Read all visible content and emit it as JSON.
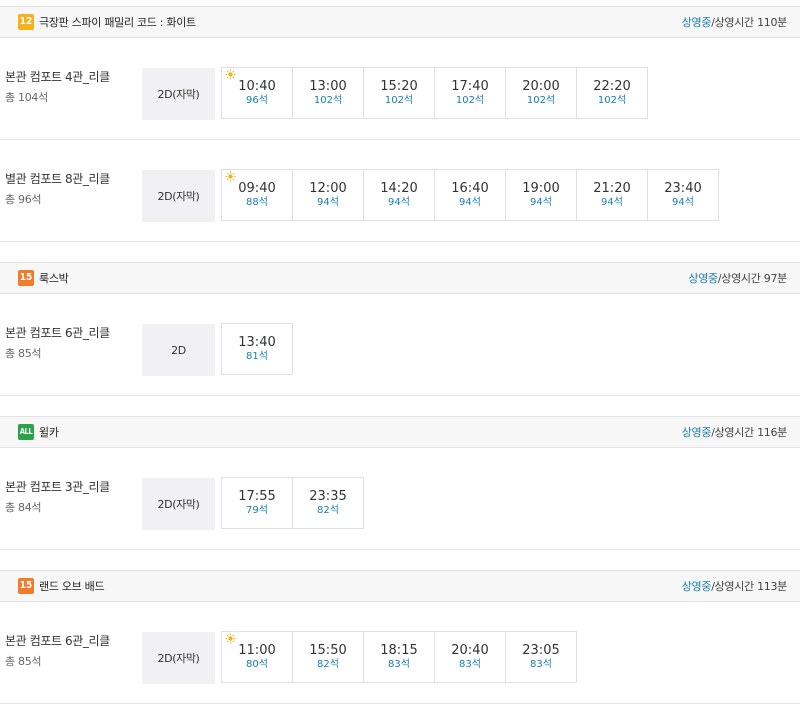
{
  "movies": [
    {
      "rating": "12",
      "title": "극장판 스파이 패밀리 코드 : 화이트",
      "status_on": "상영중",
      "status_rest": "/상영시간 110분",
      "halls": [
        {
          "name": "본관 컴포트 4관_리클",
          "total": "총 104석",
          "format": "2D(자막)",
          "times": [
            {
              "time": "10:40",
              "seats": "96석",
              "icon": "sun-icon"
            },
            {
              "time": "13:00",
              "seats": "102석"
            },
            {
              "time": "15:20",
              "seats": "102석"
            },
            {
              "time": "17:40",
              "seats": "102석"
            },
            {
              "time": "20:00",
              "seats": "102석"
            },
            {
              "time": "22:20",
              "seats": "102석"
            }
          ]
        },
        {
          "name": "별관 컴포트 8관_리클",
          "total": "총 96석",
          "format": "2D(자막)",
          "times": [
            {
              "time": "09:40",
              "seats": "88석",
              "icon": "sun-icon"
            },
            {
              "time": "12:00",
              "seats": "94석"
            },
            {
              "time": "14:20",
              "seats": "94석"
            },
            {
              "time": "16:40",
              "seats": "94석"
            },
            {
              "time": "19:00",
              "seats": "94석"
            },
            {
              "time": "21:20",
              "seats": "94석"
            },
            {
              "time": "23:40",
              "seats": "94석"
            }
          ]
        }
      ]
    },
    {
      "rating": "15",
      "title": "룩스박",
      "status_on": "상영중",
      "status_rest": "/상영시간 97분",
      "halls": [
        {
          "name": "본관 컴포트 6관_리클",
          "total": "총 85석",
          "format": "2D",
          "times": [
            {
              "time": "13:40",
              "seats": "81석"
            }
          ]
        }
      ]
    },
    {
      "rating": "ALL",
      "title": "윌카",
      "status_on": "상영중",
      "status_rest": "/상영시간 116분",
      "halls": [
        {
          "name": "본관 컴포트 3관_리클",
          "total": "총 84석",
          "format": "2D(자막)",
          "times": [
            {
              "time": "17:55",
              "seats": "79석"
            },
            {
              "time": "23:35",
              "seats": "82석"
            }
          ]
        }
      ]
    },
    {
      "rating": "15",
      "title": "랜드 오브 배드",
      "status_on": "상영중",
      "status_rest": "/상영시간 113분",
      "halls": [
        {
          "name": "본관 컴포트 6관_리클",
          "total": "총 85석",
          "format": "2D(자막)",
          "times": [
            {
              "time": "11:00",
              "seats": "80석",
              "icon": "sun-icon"
            },
            {
              "time": "15:50",
              "seats": "82석"
            },
            {
              "time": "18:15",
              "seats": "83석"
            },
            {
              "time": "20:40",
              "seats": "83석"
            },
            {
              "time": "23:05",
              "seats": "83석"
            }
          ]
        }
      ]
    }
  ],
  "colors": {
    "accent": "#1a7fb0",
    "rating_12": "#f4b11b",
    "rating_15": "#ee7c2a",
    "rating_all": "#2aa349",
    "sun": "#f5b21b"
  }
}
